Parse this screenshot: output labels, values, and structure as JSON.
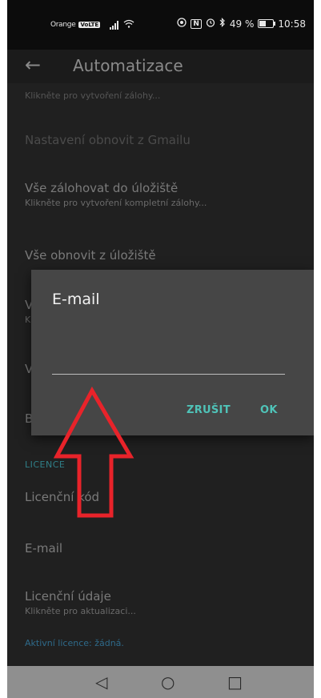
{
  "status_bar": {
    "carrier": "Orange",
    "volte": "VoLTE",
    "nfc": "N",
    "battery_percent": "49 %",
    "battery_fill_fraction": 0.49,
    "time": "10:58"
  },
  "app_bar": {
    "back_glyph": "←",
    "title": "Automatizace"
  },
  "background_list": {
    "partial_summary": "Klikněte pro vytvoření zálohy...",
    "restore_gmail": "Nastavení obnovit z Gmailu",
    "backup_all_title": "Vše zálohovat do úložiště",
    "backup_all_summary": "Klikněte pro vytvoření kompletní zálohy...",
    "restore_all_title": "Vše obnovit z úložiště",
    "hidden_item_1": "V",
    "hidden_item_1_summary": "K",
    "hidden_item_2": "V",
    "hidden_item_3": "B",
    "section_license": "LICENCE",
    "license_code": "Licenční kód",
    "email": "E-mail",
    "license_details_title": "Licenční údaje",
    "license_details_summary": "Klikněte pro aktualizaci...",
    "active_license": "Aktivní licence: žádná."
  },
  "dialog": {
    "title": "E-mail",
    "input_value": "",
    "cancel_label": "ZRUŠIT",
    "ok_label": "OK"
  },
  "nav_bar": {
    "back_glyph": "◁",
    "home_glyph": "○",
    "recent_glyph": "□"
  },
  "colors": {
    "accent": "#4fc3b8",
    "annotation_arrow": "#e8232a"
  }
}
